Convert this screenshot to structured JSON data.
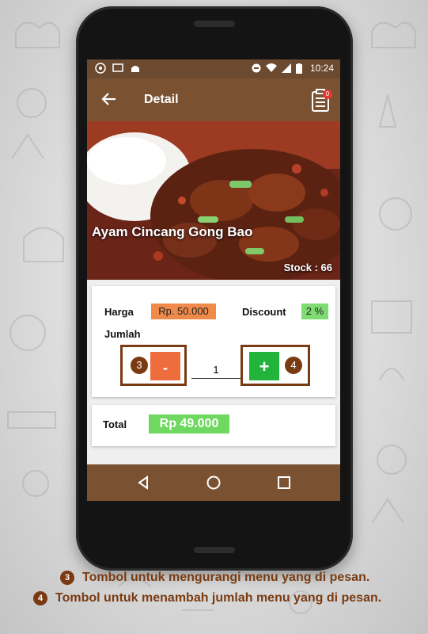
{
  "statusbar": {
    "time": "10:24"
  },
  "toolbar": {
    "title": "Detail",
    "cart_badge": "0"
  },
  "product": {
    "name": "Ayam Cincang Gong Bao",
    "stock_label": "Stock : 66"
  },
  "detail": {
    "price_label": "Harga",
    "price_value": "Rp. 50.000",
    "discount_label": "Discount",
    "discount_value": "2 %",
    "qty_label": "Jumlah",
    "minus_label": "-",
    "plus_label": "+",
    "qty_value": "1",
    "callout_minus": "3",
    "callout_plus": "4"
  },
  "total": {
    "label": "Total",
    "value": "Rp 49.000"
  },
  "legend": [
    {
      "num": "3",
      "text": "Tombol untuk mengurangi menu yang di pesan."
    },
    {
      "num": "4",
      "text": "Tombol untuk menambah jumlah menu yang di pesan."
    }
  ],
  "colors": {
    "toolbar": "#7a5232",
    "statusbar": "#6b4a30",
    "price_tag": "#f08a4b",
    "discount_tag": "#7fdc72",
    "minus_button": "#ef6c3c",
    "plus_button": "#22b33a",
    "total_tag": "#6fd860",
    "callout": "#7a3b12"
  },
  "icons": [
    "back-arrow-icon",
    "cart-list-icon",
    "nav-back-icon",
    "nav-home-icon",
    "nav-recents-icon",
    "wifi-icon",
    "signal-icon",
    "battery-icon"
  ]
}
